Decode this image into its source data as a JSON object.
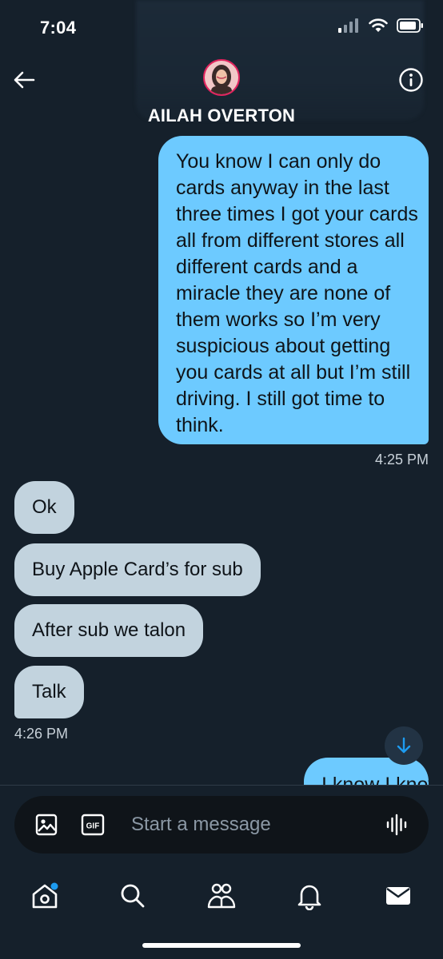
{
  "status_bar": {
    "time": "7:04"
  },
  "header": {
    "contact_name": "AILAH OVERTON"
  },
  "messages": {
    "outgoing_1": {
      "lines": [
        "You know I can only do",
        "cards anyway in the last",
        "three times I got your cards",
        "all from different stores all",
        "different cards and a",
        "miracle they are none of",
        "them works so I’m very",
        "suspicious about getting",
        "you cards at all but I’m still",
        "driving. I still got time to",
        "think."
      ],
      "time": "4:25 PM"
    },
    "incoming": [
      {
        "text": "Ok"
      },
      {
        "text": "Buy Apple Card’s for sub"
      },
      {
        "text": "After sub we talon"
      },
      {
        "text": "Talk"
      }
    ],
    "incoming_time": "4:26 PM",
    "outgoing_2": {
      "text": "I know I know"
    }
  },
  "composer": {
    "placeholder": "Start a message"
  },
  "colors": {
    "background": "#15202b",
    "outgoing_bubble": "#6dcaff",
    "incoming_bubble": "#c2d3de",
    "accent": "#1d9bf0"
  }
}
